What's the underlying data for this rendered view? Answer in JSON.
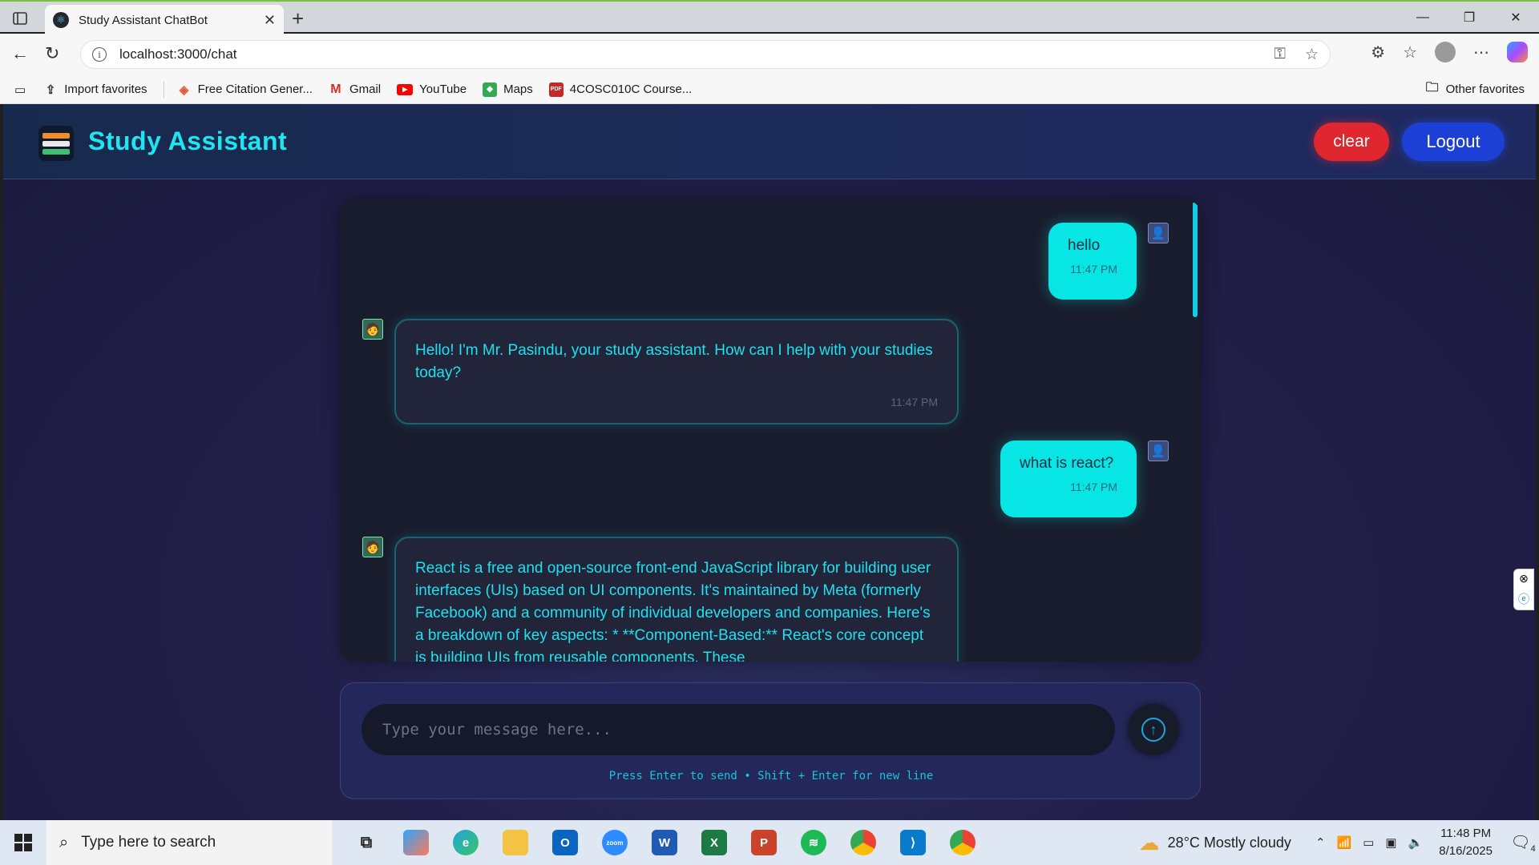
{
  "browser": {
    "tab_title": "Study Assistant ChatBot",
    "url": "localhost:3000/chat",
    "bookmarks": [
      {
        "label": "Import favorites",
        "icon": "import-icon"
      },
      {
        "label": "Free Citation Gener...",
        "icon": "citation-icon"
      },
      {
        "label": "Gmail",
        "icon": "gmail-icon"
      },
      {
        "label": "YouTube",
        "icon": "youtube-icon"
      },
      {
        "label": "Maps",
        "icon": "maps-icon"
      },
      {
        "label": "4COSC010C Course...",
        "icon": "pdf-icon"
      }
    ],
    "other_favorites": "Other favorites"
  },
  "app": {
    "title": "Study Assistant",
    "clear_label": "clear",
    "logout_label": "Logout",
    "accent_color": "#20e5f0"
  },
  "messages": [
    {
      "sender": "user",
      "text": "hello",
      "time": "11:47 PM"
    },
    {
      "sender": "bot",
      "text": "Hello! I'm Mr. Pasindu, your study assistant. How can I help with your studies today?",
      "time": "11:47 PM"
    },
    {
      "sender": "user",
      "text": "what is react?",
      "time": "11:47 PM"
    },
    {
      "sender": "bot",
      "text": "React is a free and open-source front-end JavaScript library for building user interfaces (UIs) based on UI components. It's maintained by Meta (formerly Facebook) and a community of individual developers and companies. Here's a breakdown of key aspects: * **Component-Based:** React's core concept is building UIs from reusable components. These",
      "time": ""
    }
  ],
  "composer": {
    "placeholder": "Type your message here...",
    "hint": "Press Enter to send • Shift + Enter for new line"
  },
  "taskbar": {
    "search_placeholder": "Type here to search",
    "weather": "28°C  Mostly cloudy",
    "time": "11:48 PM",
    "date": "8/16/2025",
    "notifications": "4"
  }
}
